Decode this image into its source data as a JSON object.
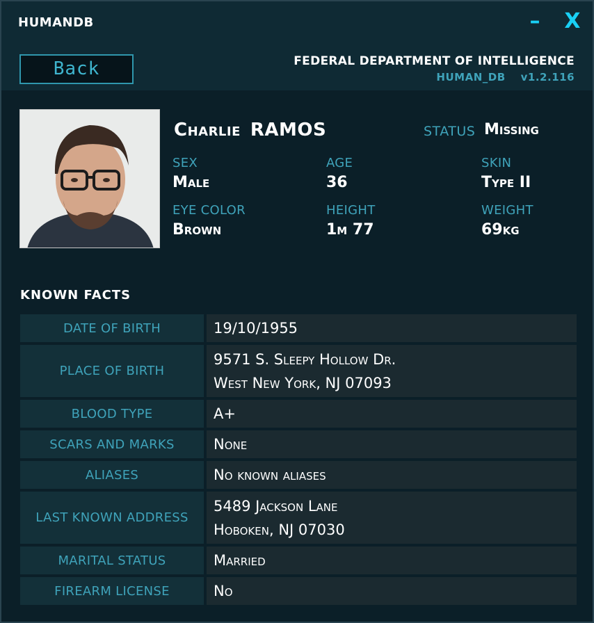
{
  "titlebar": {
    "app_title": "HUMANDB",
    "minimize_label": "–",
    "close_label": "X"
  },
  "header": {
    "back_label": "Back",
    "org_name": "FEDERAL DEPARTMENT OF INTELLIGENCE",
    "db_name": "HUMAN_DB",
    "version": "v1.2.116"
  },
  "profile": {
    "first_name": "Charlie",
    "last_name": "RAMOS",
    "status_label": "STATUS",
    "status_value": "Missing",
    "sex_label": "SEX",
    "sex_value": "Male",
    "age_label": "AGE",
    "age_value": "36",
    "skin_label": "SKIN",
    "skin_value": "Type II",
    "eye_label": "EYE COLOR",
    "eye_value": "Brown",
    "height_label": "HEIGHT",
    "height_value": "1m 77",
    "weight_label": "WEIGHT",
    "weight_value": "69kg"
  },
  "facts": {
    "title": "KNOWN  FACTS",
    "rows": [
      {
        "label": "DATE OF BIRTH",
        "line1": "19/10/1955",
        "line2": ""
      },
      {
        "label": "PLACE OF BIRTH",
        "line1": "9571 S. Sleepy Hollow Dr.",
        "line2": "West New York, NJ 07093"
      },
      {
        "label": "BLOOD TYPE",
        "line1": "A+",
        "line2": ""
      },
      {
        "label": "SCARS AND MARKS",
        "line1": "None",
        "line2": ""
      },
      {
        "label": "ALIASES",
        "line1": "No known aliases",
        "line2": ""
      },
      {
        "label": "LAST KNOWN ADDRESS",
        "line1": "5489 Jackson Lane",
        "line2": "Hoboken, NJ 07030"
      },
      {
        "label": "MARITAL STATUS",
        "line1": "Married",
        "line2": ""
      },
      {
        "label": "FIREARM LICENSE",
        "line1": "No",
        "line2": ""
      }
    ]
  },
  "colors": {
    "accent": "#19d0f5",
    "label": "#3fa3ba",
    "background": "#0b1f28"
  }
}
